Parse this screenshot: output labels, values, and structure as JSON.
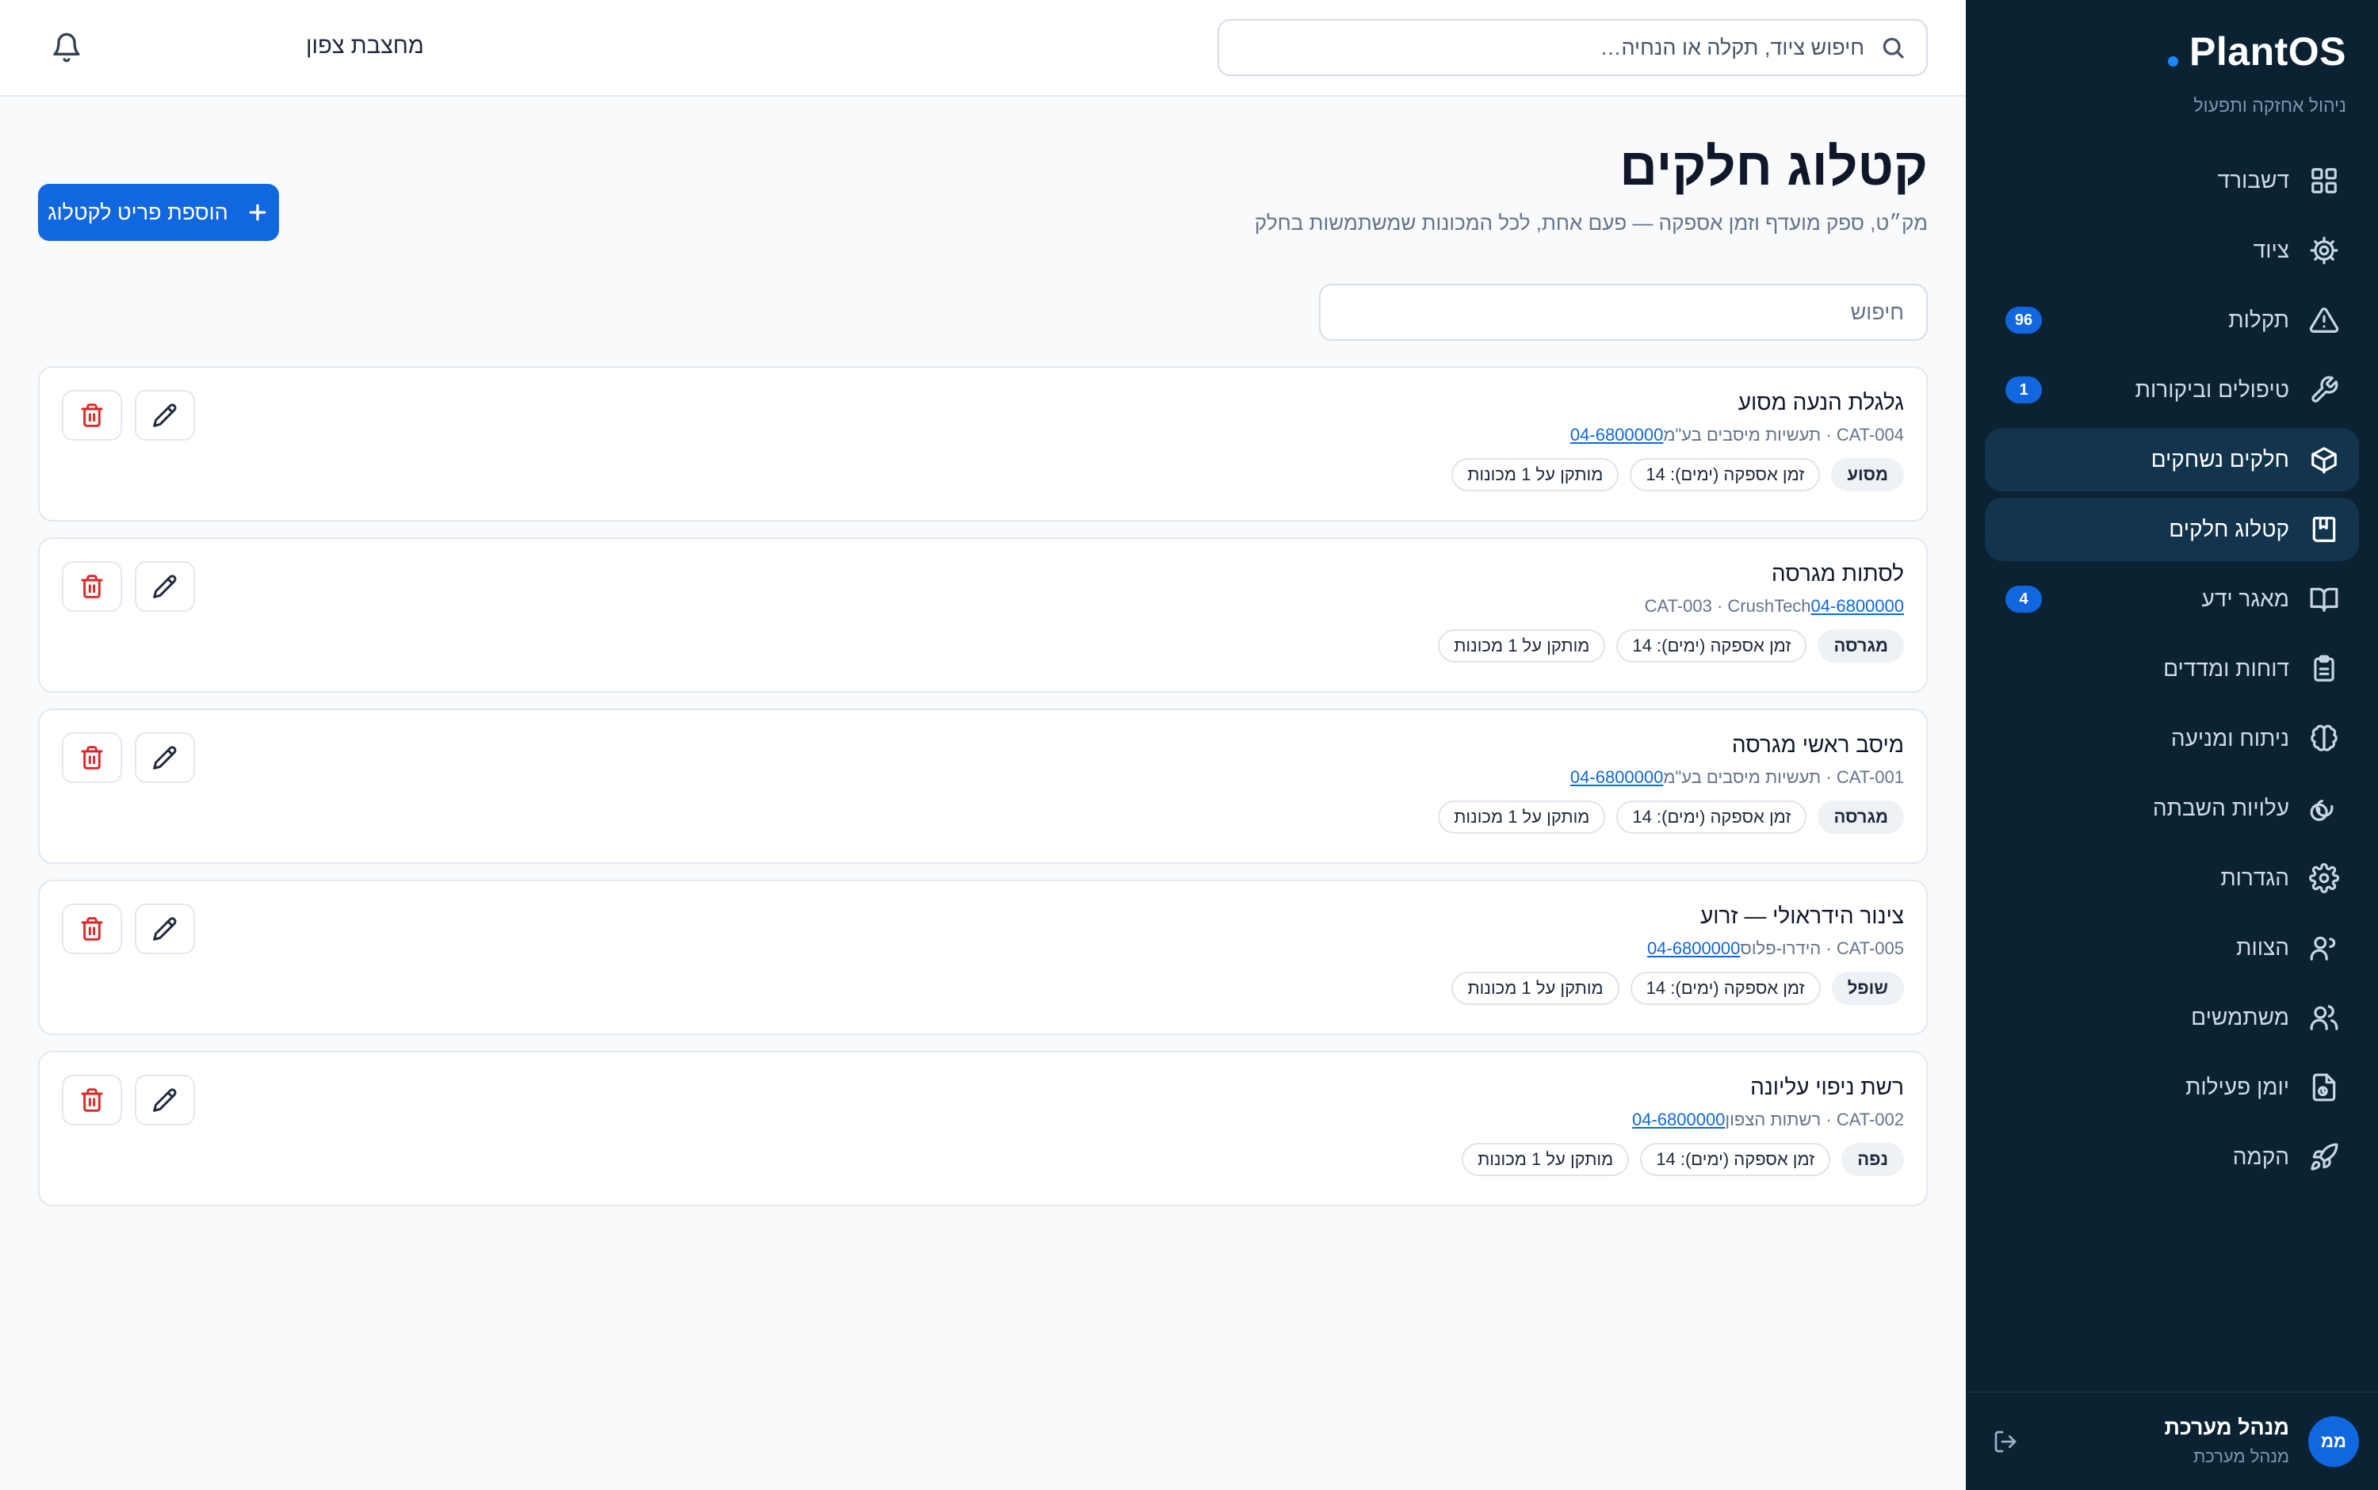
{
  "brand": {
    "name": "PlantOS",
    "subtitle": "ניהול אחזקה ותפעול",
    "accent": "#1e88ff"
  },
  "sidebar": {
    "items": [
      {
        "label": "דשבורד",
        "icon": "dashboard-icon",
        "badge": "",
        "active": false
      },
      {
        "label": "ציוד",
        "icon": "gear-icon",
        "badge": "",
        "active": false
      },
      {
        "label": "תקלות",
        "icon": "warning-icon",
        "badge": "96",
        "active": false
      },
      {
        "label": "טיפולים וביקורות",
        "icon": "wrench-icon",
        "badge": "1",
        "active": false
      },
      {
        "label": "חלקים נשחקים",
        "icon": "box-icon",
        "badge": "",
        "active": true
      },
      {
        "label": "קטלוג חלקים",
        "icon": "catalog-icon",
        "badge": "",
        "active": true
      },
      {
        "label": "מאגר ידע",
        "icon": "book-icon",
        "badge": "4",
        "active": false
      },
      {
        "label": "דוחות ומדדים",
        "icon": "clipboard-icon",
        "badge": "",
        "active": false
      },
      {
        "label": "ניתוח ומניעה",
        "icon": "brain-icon",
        "badge": "",
        "active": false
      },
      {
        "label": "עלויות השבתה",
        "icon": "coins-icon",
        "badge": "",
        "active": false
      },
      {
        "label": "הגדרות",
        "icon": "settings-icon",
        "badge": "",
        "active": false
      },
      {
        "label": "הצוות",
        "icon": "user-icon",
        "badge": "",
        "active": false
      },
      {
        "label": "משתמשים",
        "icon": "users-icon",
        "badge": "",
        "active": false
      },
      {
        "label": "יומן פעילות",
        "icon": "activity-log-icon",
        "badge": "",
        "active": false
      },
      {
        "label": "הקמה",
        "icon": "rocket-icon",
        "badge": "",
        "active": false
      }
    ],
    "user": {
      "initials": "ממ",
      "name": "מנהל מערכת",
      "role": "מנהל מערכת"
    }
  },
  "topbar": {
    "search_placeholder": "חיפוש ציוד, תקלה או הנחיה…",
    "site": "מחצבת צפון"
  },
  "page": {
    "title": "קטלוג חלקים",
    "subtitle": "מק״ט, ספק מועדף וזמן אספקה — פעם אחת, לכל המכונות שמשתמשות בחלק",
    "add_button": "הוספת פריט לקטלוג",
    "filter_placeholder": "חיפוש"
  },
  "parts": [
    {
      "name": "גלגלת הנעה מסוע",
      "sku": "CAT-004",
      "supplier": "תעשיות מיסבים בע\"מ",
      "phone": "04-6800000",
      "category": "מסוע",
      "lead_time": "זמן אספקה (ימים): 14",
      "installed": "מותקן על 1 מכונות"
    },
    {
      "name": "לסתות מגרסה",
      "sku": "CAT-003",
      "supplier": "CrushTech",
      "phone": "04-6800000",
      "category": "מגרסה",
      "lead_time": "זמן אספקה (ימים): 14",
      "installed": "מותקן על 1 מכונות"
    },
    {
      "name": "מיסב ראשי מגרסה",
      "sku": "CAT-001",
      "supplier": "תעשיות מיסבים בע\"מ",
      "phone": "04-6800000",
      "category": "מגרסה",
      "lead_time": "זמן אספקה (ימים): 14",
      "installed": "מותקן על 1 מכונות"
    },
    {
      "name": "צינור הידראולי — זרוע",
      "sku": "CAT-005",
      "supplier": "הידרו-פלוס",
      "phone": "04-6800000",
      "category": "שופל",
      "lead_time": "זמן אספקה (ימים): 14",
      "installed": "מותקן על 1 מכונות"
    },
    {
      "name": "רשת ניפוי עליונה",
      "sku": "CAT-002",
      "supplier": "רשתות הצפון",
      "phone": "04-6800000",
      "category": "נפה",
      "lead_time": "זמן אספקה (ימים): 14",
      "installed": "מותקן על 1 מכונות"
    }
  ],
  "colors": {
    "sidebar_bg": "#0b2233",
    "primary": "#1167e0",
    "danger": "#dc2626"
  }
}
